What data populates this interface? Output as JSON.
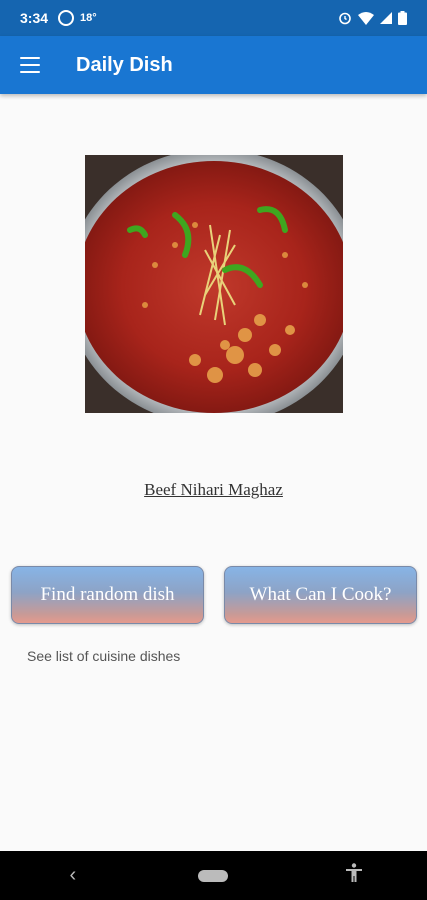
{
  "status_bar": {
    "time": "3:34",
    "temperature": "18°"
  },
  "app_bar": {
    "title": "Daily Dish"
  },
  "dish": {
    "name": "Beef Nihari Maghaz"
  },
  "buttons": {
    "random_label": "Find random dish",
    "cook_label": "What Can I Cook?"
  },
  "links": {
    "cuisine_label": "See list of cuisine dishes"
  },
  "colors": {
    "status_bar": "#1565b0",
    "app_bar": "#1976d2"
  },
  "icons": [
    "whatsapp-icon",
    "alarm-icon",
    "wifi-icon",
    "signal-icon",
    "battery-icon",
    "menu-icon",
    "back-icon",
    "home-icon",
    "accessibility-icon"
  ]
}
